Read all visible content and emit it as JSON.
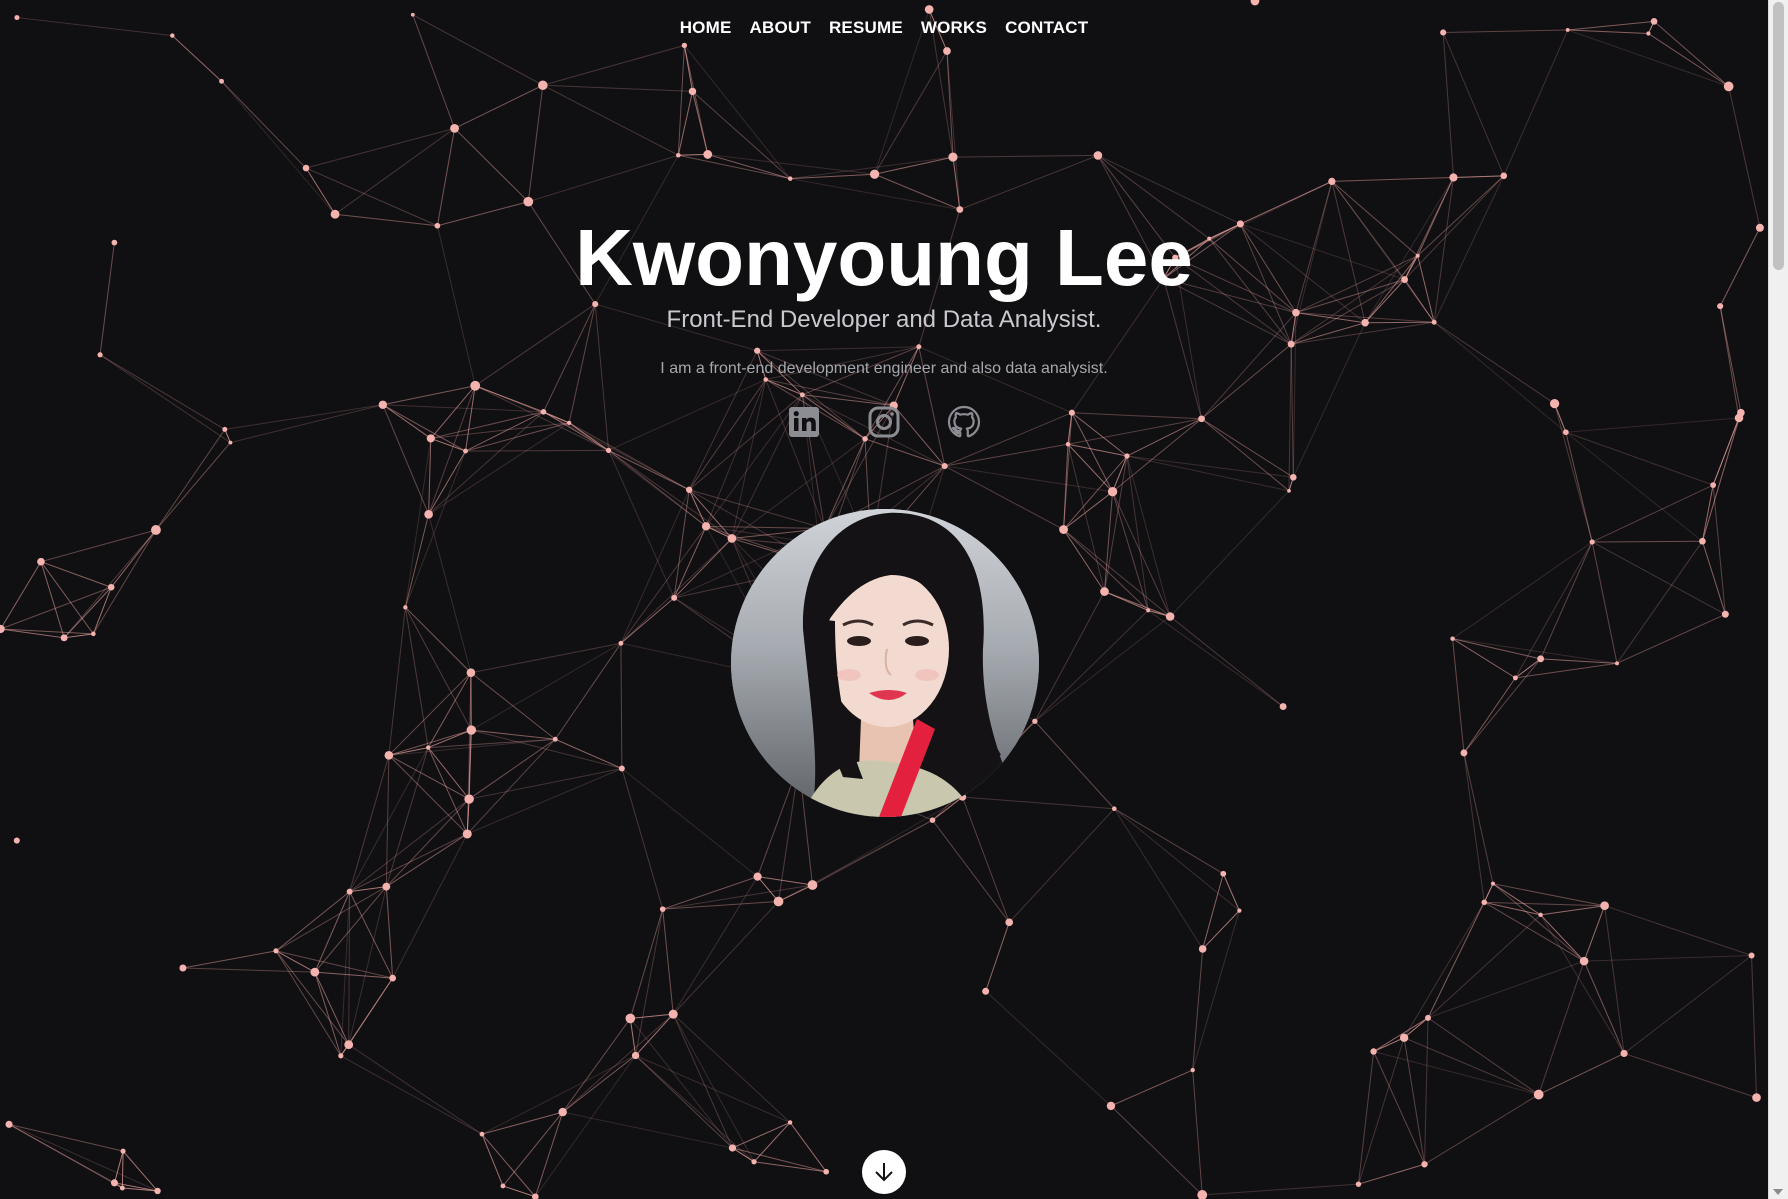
{
  "nav": {
    "items": [
      {
        "label": "HOME"
      },
      {
        "label": "ABOUT"
      },
      {
        "label": "RESUME"
      },
      {
        "label": "WORKS"
      },
      {
        "label": "CONTACT"
      }
    ]
  },
  "hero": {
    "title": "Kwonyoung Lee",
    "subtitle": "Front-End Developer and Data Analysist.",
    "description": "I am a front-end development engineer and also data analysist."
  },
  "social": {
    "icons": [
      "linkedin-icon",
      "instagram-icon",
      "github-icon"
    ],
    "icon_color": "#8c8c93"
  },
  "colors": {
    "background": "#101013",
    "network": "#f1a7a3",
    "title": "#ffffff"
  }
}
